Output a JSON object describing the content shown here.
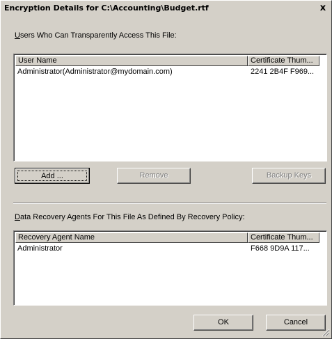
{
  "window": {
    "title": "Encryption Details for C:\\Accounting\\Budget.rtf",
    "close_symbol": "x"
  },
  "users_section": {
    "label": "Users Who Can Transparently Access This File:",
    "label_mnemonic": "U",
    "label_rest": "sers Who Can Transparently Access This File:",
    "columns": [
      "User Name",
      "Certificate Thum..."
    ],
    "rows": [
      {
        "name": "Administrator(Administrator@mydomain.com)",
        "thumbprint": "2241 2B4F F969..."
      }
    ]
  },
  "buttons": {
    "add": "Add ...",
    "remove": "Remove",
    "backup_keys": "Backup Keys",
    "ok": "OK",
    "cancel": "Cancel"
  },
  "recovery_section": {
    "label": "Data Recovery Agents For This File As Defined By Recovery Policy:",
    "label_mnemonic": "D",
    "label_rest": "ata Recovery Agents For This File As Defined By Recovery Policy:",
    "columns": [
      "Recovery Agent Name",
      "Certificate Thum..."
    ],
    "rows": [
      {
        "name": "Administrator",
        "thumbprint": "F668 9D9A 117..."
      }
    ]
  }
}
